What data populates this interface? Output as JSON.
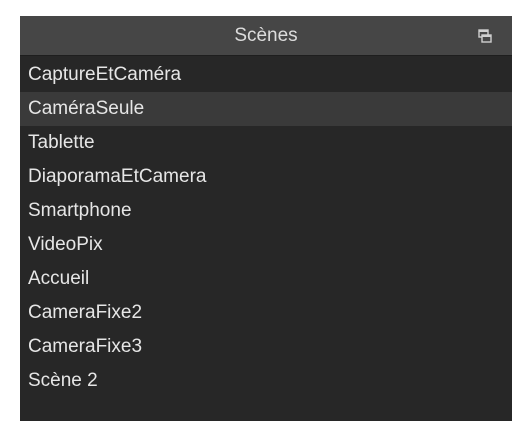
{
  "panel": {
    "title": "Scènes",
    "undock_icon": "float-window-icon"
  },
  "scenes": {
    "items": [
      {
        "label": "CaptureEtCaméra",
        "selected": false
      },
      {
        "label": "CaméraSeule",
        "selected": true
      },
      {
        "label": "Tablette",
        "selected": false
      },
      {
        "label": "DiaporamaEtCamera",
        "selected": false
      },
      {
        "label": "Smartphone",
        "selected": false
      },
      {
        "label": "VideoPix",
        "selected": false
      },
      {
        "label": "Accueil",
        "selected": false
      },
      {
        "label": "CameraFixe2",
        "selected": false
      },
      {
        "label": "CameraFixe3",
        "selected": false
      },
      {
        "label": "Scène 2",
        "selected": false
      }
    ]
  },
  "colors": {
    "panel_background": "#272727",
    "title_background": "#464646",
    "selected_row": "#3a3a3a",
    "text": "#e6e6e6"
  }
}
